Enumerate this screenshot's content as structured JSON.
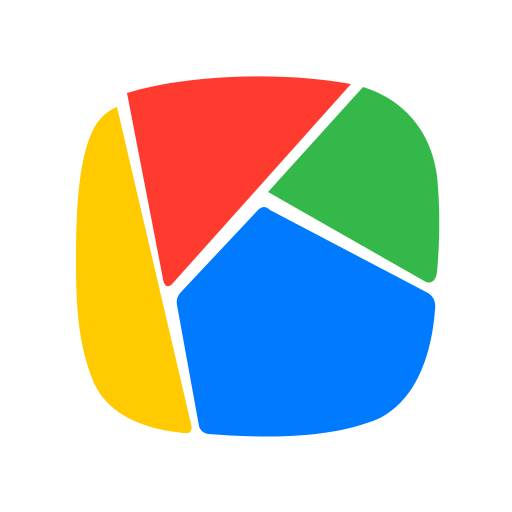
{
  "icon": {
    "name": "app-icon",
    "colors": {
      "red": "#FF3B30",
      "green": "#34B84A",
      "blue": "#007AFF",
      "yellow": "#FFCA00",
      "background": "#FFFFFF"
    }
  }
}
